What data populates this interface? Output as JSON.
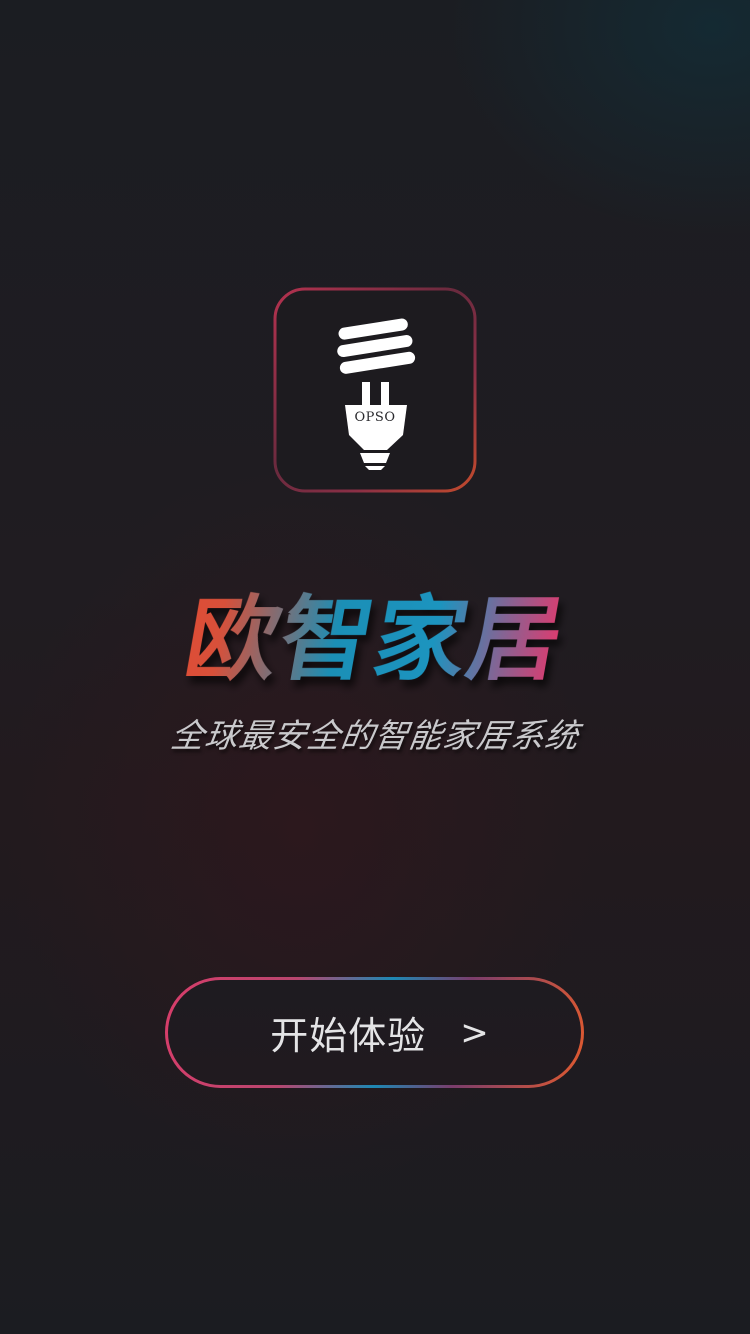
{
  "app": {
    "logo_text": "OPSO",
    "title": "欧智家居",
    "subtitle": "全球最安全的智能家居系统"
  },
  "start": {
    "label": "开始体验",
    "arrow": ">"
  },
  "colors": {
    "background": "#1c1b1f",
    "accent_red": "#e8482f",
    "accent_blue": "#1b8fb6",
    "accent_pink": "#e03a6e",
    "text_light": "#e4e4e6"
  }
}
